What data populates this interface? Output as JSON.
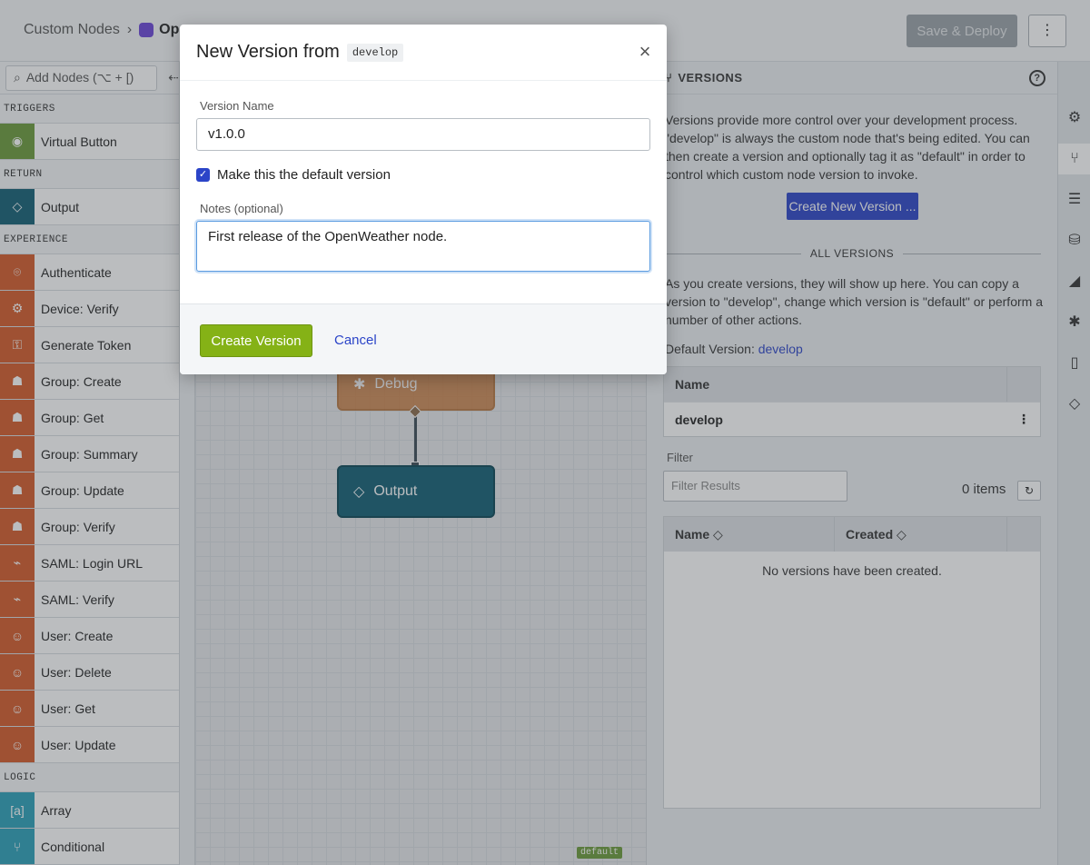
{
  "header": {
    "breadcrumb_root": "Custom Nodes",
    "breadcrumb_sep": "›",
    "breadcrumb_current": "Ope",
    "save_deploy": "Save & Deploy",
    "more": "⋮"
  },
  "palette": {
    "search_placeholder": "Add Nodes (⌥ + [)",
    "collapse": "⇠",
    "categories": [
      {
        "label": "TRIGGERS",
        "items": [
          {
            "label": "Virtual Button",
            "color": "green",
            "icon": "◉"
          }
        ]
      },
      {
        "label": "RETURN",
        "items": [
          {
            "label": "Output",
            "color": "teal",
            "icon": "◇"
          }
        ]
      },
      {
        "label": "EXPERIENCE",
        "items": [
          {
            "label": "Authenticate",
            "color": "orange",
            "icon": "⌾"
          },
          {
            "label": "Device: Verify",
            "color": "orange",
            "icon": "⚙"
          },
          {
            "label": "Generate Token",
            "color": "orange",
            "icon": "⚿"
          },
          {
            "label": "Group: Create",
            "color": "orange",
            "icon": "☗"
          },
          {
            "label": "Group: Get",
            "color": "orange",
            "icon": "☗"
          },
          {
            "label": "Group: Summary",
            "color": "orange",
            "icon": "☗"
          },
          {
            "label": "Group: Update",
            "color": "orange",
            "icon": "☗"
          },
          {
            "label": "Group: Verify",
            "color": "orange",
            "icon": "☗"
          },
          {
            "label": "SAML: Login URL",
            "color": "orange",
            "icon": "⌁"
          },
          {
            "label": "SAML: Verify",
            "color": "orange",
            "icon": "⌁"
          },
          {
            "label": "User: Create",
            "color": "orange",
            "icon": "☺"
          },
          {
            "label": "User: Delete",
            "color": "orange",
            "icon": "☺"
          },
          {
            "label": "User: Get",
            "color": "orange",
            "icon": "☺"
          },
          {
            "label": "User: Update",
            "color": "orange",
            "icon": "☺"
          }
        ]
      },
      {
        "label": "LOGIC",
        "items": [
          {
            "label": "Array",
            "color": "cyan",
            "icon": "[a]"
          },
          {
            "label": "Conditional",
            "color": "cyan",
            "icon": "⑂"
          }
        ]
      }
    ]
  },
  "canvas": {
    "debug_label": "Debug",
    "output_label": "Output",
    "default_tag": "default"
  },
  "versions": {
    "title": "VERSIONS",
    "help": "?",
    "intro": "Versions provide more control over your development process. \"develop\" is always the custom node that's being edited. You can then create a version and optionally tag it as \"default\" in order to control which custom node version to invoke.",
    "create_new": "Create New Version ...",
    "all_versions": "ALL VERSIONS",
    "all_intro": "As you create versions, they will show up here. You can copy a version to \"develop\", change which version is \"default\" or perform a number of other actions.",
    "default_label": "Default Version:",
    "default_value": "develop",
    "table1_header": "Name",
    "table1_row": "develop",
    "row_menu": "⋮",
    "filter_label": "Filter",
    "filter_placeholder": "Filter Results",
    "items_count": "0 items",
    "refresh": "↻",
    "col_name": "Name ◇",
    "col_created": "Created ◇",
    "empty": "No versions have been created."
  },
  "modal": {
    "title": "New Version from",
    "source": "develop",
    "close": "×",
    "version_name_label": "Version Name",
    "version_name_value": "v1.0.0",
    "default_check_label": "Make this the default version",
    "notes_label": "Notes (optional)",
    "notes_value": "First release of the OpenWeather node.",
    "create_button": "Create Version",
    "cancel_button": "Cancel"
  },
  "colors": {
    "primary": "#2b44c8",
    "create_green": "#85b216",
    "node_orange": "#d45a28",
    "node_teal": "#115e74"
  }
}
